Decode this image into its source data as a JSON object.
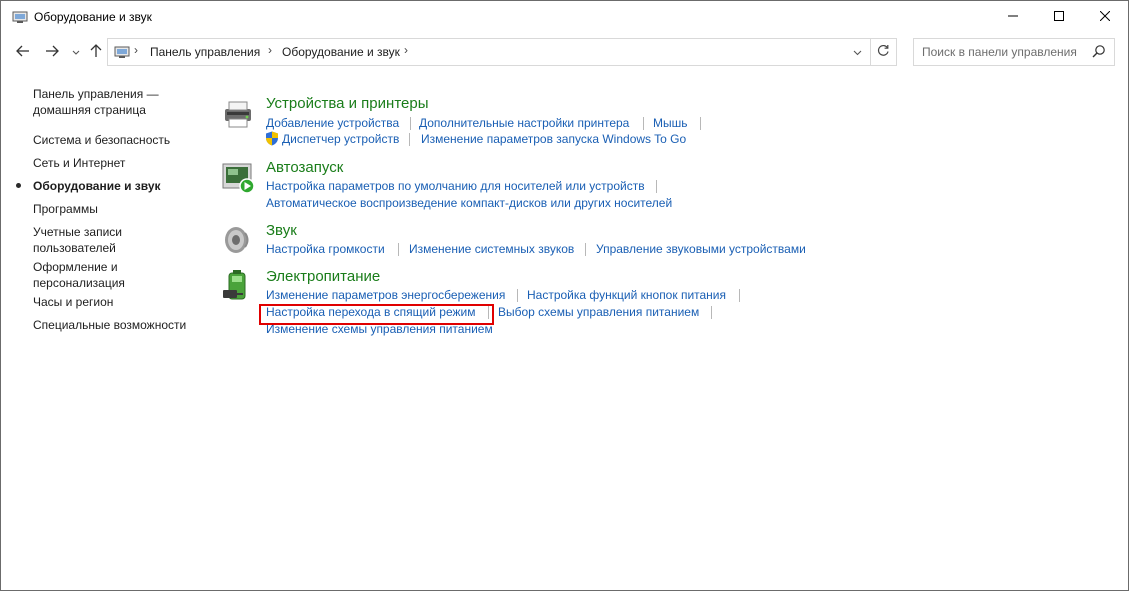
{
  "window": {
    "title": "Оборудование и звук"
  },
  "address": {
    "crumbs": [
      "Панель управления",
      "Оборудование и звук"
    ],
    "search_placeholder": "Поиск в панели управления"
  },
  "sidebar": {
    "items": [
      {
        "label": "Панель управления —\nдомашняя страница"
      },
      {
        "label": "Система и безопасность"
      },
      {
        "label": "Сеть и Интернет"
      },
      {
        "label": "Оборудование и звук",
        "active": true
      },
      {
        "label": "Программы"
      },
      {
        "label": "Учетные записи\nпользователей"
      },
      {
        "label": "Оформление и\nперсонализация"
      },
      {
        "label": "Часы и регион"
      },
      {
        "label": "Специальные возможности"
      }
    ]
  },
  "sections": {
    "devices": {
      "title": "Устройства и принтеры",
      "links": [
        "Добавление устройства",
        "Дополнительные настройки принтера",
        "Мышь",
        "Диспетчер устройств",
        "Изменение параметров запуска Windows To Go"
      ]
    },
    "autoplay": {
      "title": "Автозапуск",
      "links": [
        "Настройка параметров по умолчанию для носителей или устройств",
        "Автоматическое воспроизведение компакт-дисков или других носителей"
      ]
    },
    "sound": {
      "title": "Звук",
      "links": [
        "Настройка громкости",
        "Изменение системных звуков",
        "Управление звуковыми устройствами"
      ]
    },
    "power": {
      "title": "Электропитание",
      "links": [
        "Изменение параметров энергосбережения",
        "Настройка функций кнопок питания",
        "Настройка перехода в спящий режим",
        "Выбор схемы управления питанием",
        "Изменение схемы управления питанием"
      ]
    }
  },
  "colors": {
    "section_title": "#1a7d1a",
    "link": "#1a5fb4",
    "highlight_border": "#e00000"
  },
  "icons": [
    "control-panel-icon",
    "minimize-icon",
    "maximize-icon",
    "close-icon",
    "back-arrow-icon",
    "forward-arrow-icon",
    "recent-dropdown-icon",
    "up-arrow-icon",
    "refresh-icon",
    "search-icon",
    "devices-printers-icon",
    "shield-icon",
    "autoplay-icon",
    "speaker-icon",
    "battery-icon"
  ]
}
